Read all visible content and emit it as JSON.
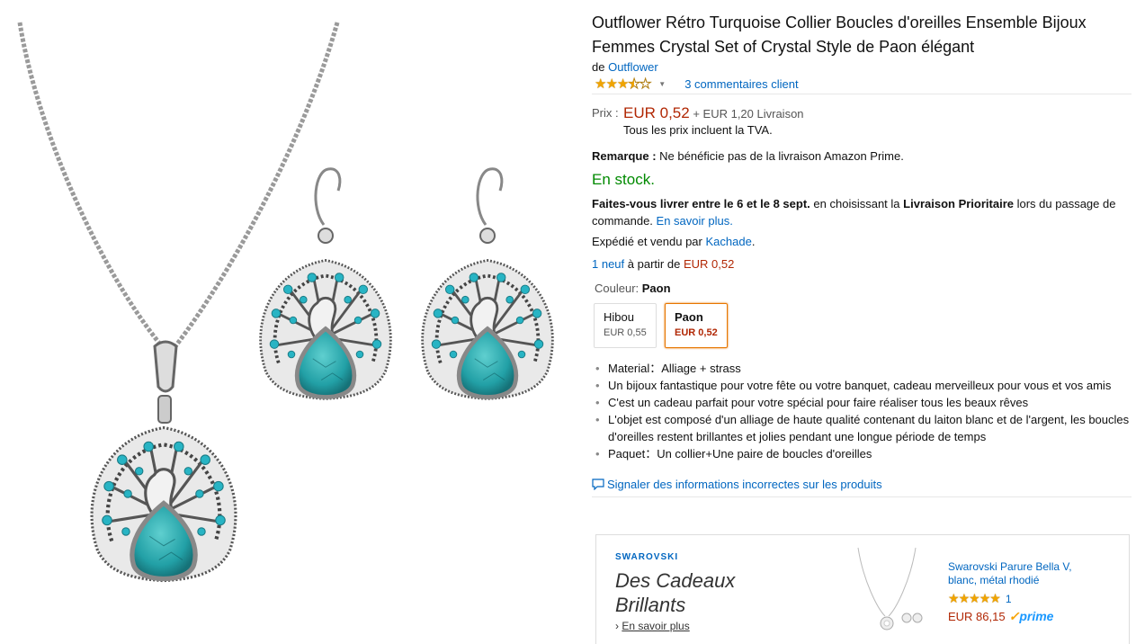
{
  "product": {
    "title": "Outflower Rétro Turquoise Collier Boucles d'oreilles Ensemble Bijoux Femmes Crystal Set of Crystal Style de Paon élégant",
    "by_prefix": "de",
    "brand": "Outflower",
    "rating_stars": 3.5,
    "reviews_link": "3 commentaires client",
    "price_label": "Prix :",
    "price": "EUR 0,52",
    "shipping": "+ EUR 1,20 Livraison",
    "vat_note": "Tous les prix incluent la TVA.",
    "remark_label": "Remarque :",
    "remark_text": "Ne bénéficie pas de la livraison Amazon Prime.",
    "stock": "En stock.",
    "delivery_bold": "Faites-vous livrer entre le 6 et le 8 sept.",
    "delivery_mid": "en choisissant la",
    "delivery_bold2": "Livraison Prioritaire",
    "delivery_end": "lors du passage de commande.",
    "learn_more": "En savoir plus.",
    "shipped_prefix": "Expédié et vendu par",
    "seller": "Kachade",
    "offers_link": "1 neuf",
    "offers_mid": "à partir de",
    "offers_price": "EUR 0,52",
    "color_label": "Couleur:",
    "color_selected": "Paon",
    "swatches": [
      {
        "name": "Hibou",
        "price": "EUR 0,55"
      },
      {
        "name": "Paon",
        "price": "EUR 0,52"
      }
    ],
    "bullets": [
      "Material：Alliage + strass",
      "Un bijoux fantastique pour votre fête ou votre banquet, cadeau merveilleux pour vous et vos amis",
      "C'est un cadeau parfait pour votre spécial pour faire réaliser tous les beaux rêves",
      "L'objet est composé d'un alliage de haute qualité contenant du laiton blanc et de l'argent, les boucles d'oreilles restent brillantes et jolies pendant une longue période de temps",
      "Paquet：Un collier+Une paire de boucles d'oreilles"
    ],
    "report_link": "Signaler des informations incorrectes sur les produits"
  },
  "ad": {
    "brand": "SWAROVSKI",
    "headline": "Des Cadeaux Brillants",
    "more_link": "En savoir plus",
    "product_title": "Swarovski Parure Bella V, blanc, métal rhodié",
    "rating_stars": 5,
    "rating_count": "1",
    "price": "EUR 86,15",
    "prime": "prime"
  },
  "colors": {
    "link": "#0066c0",
    "price": "#b12704",
    "stock": "#008a00",
    "star": "#f0a400",
    "turquoise": "#2aa6a8",
    "swatch_selected": "#e77600"
  }
}
